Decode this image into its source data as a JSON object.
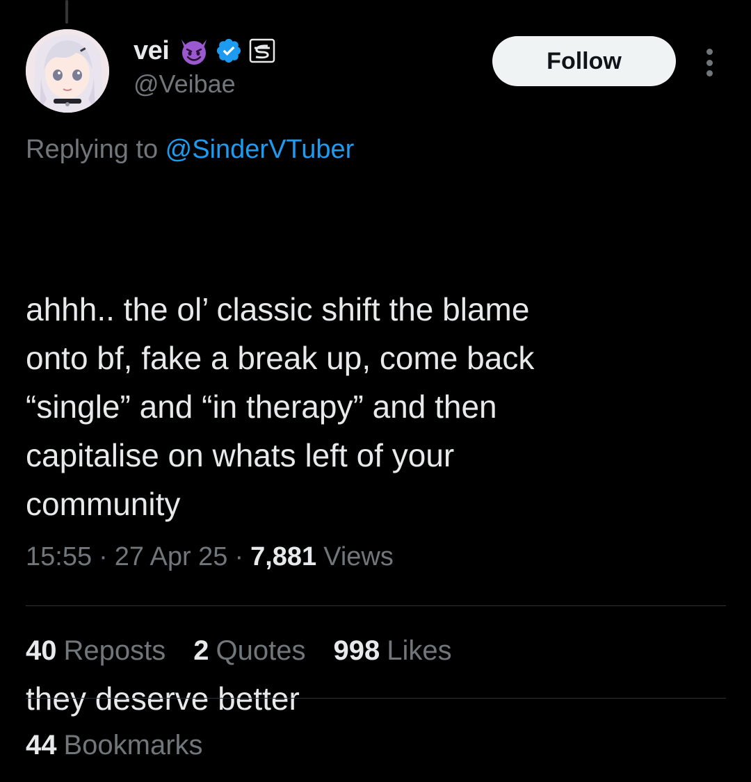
{
  "colors": {
    "background": "#000000",
    "text_primary": "#e7e9ea",
    "text_secondary": "#71767b",
    "link": "#1d9bf0",
    "verified": "#1d9bf0",
    "emoji": "#9b59d0",
    "follow_bg": "#eff3f4",
    "divider": "#2f3336"
  },
  "author": {
    "display_name": "vei",
    "handle": "@Veibae",
    "name_emoji_icon": "smiling-devil-emoji-icon",
    "verified_icon": "verified-badge-icon",
    "affiliate_icon": "affiliate-badge-icon",
    "avatar_icon": "anime-avatar-icon"
  },
  "follow_button": {
    "label": "Follow"
  },
  "more_icon": "more-options-vertical-icon",
  "reply_context": {
    "prefix": "Replying to ",
    "mention": "@SinderVTuber"
  },
  "tweet": {
    "paragraph_1": "ahhh.. the ol’ classic shift the blame\nonto bf, fake a break up, come back\n“single” and “in therapy” and then\ncapitalise on whats left of your\ncommunity",
    "paragraph_2": "they deserve better"
  },
  "meta": {
    "time": "15:55",
    "separator": "·",
    "date": "27 Apr 25",
    "views_count": "7,881",
    "views_label": "Views"
  },
  "stats": {
    "reposts_count": "40",
    "reposts_label": "Reposts",
    "quotes_count": "2",
    "quotes_label": "Quotes",
    "likes_count": "998",
    "likes_label": "Likes",
    "bookmarks_count": "44",
    "bookmarks_label": "Bookmarks"
  }
}
